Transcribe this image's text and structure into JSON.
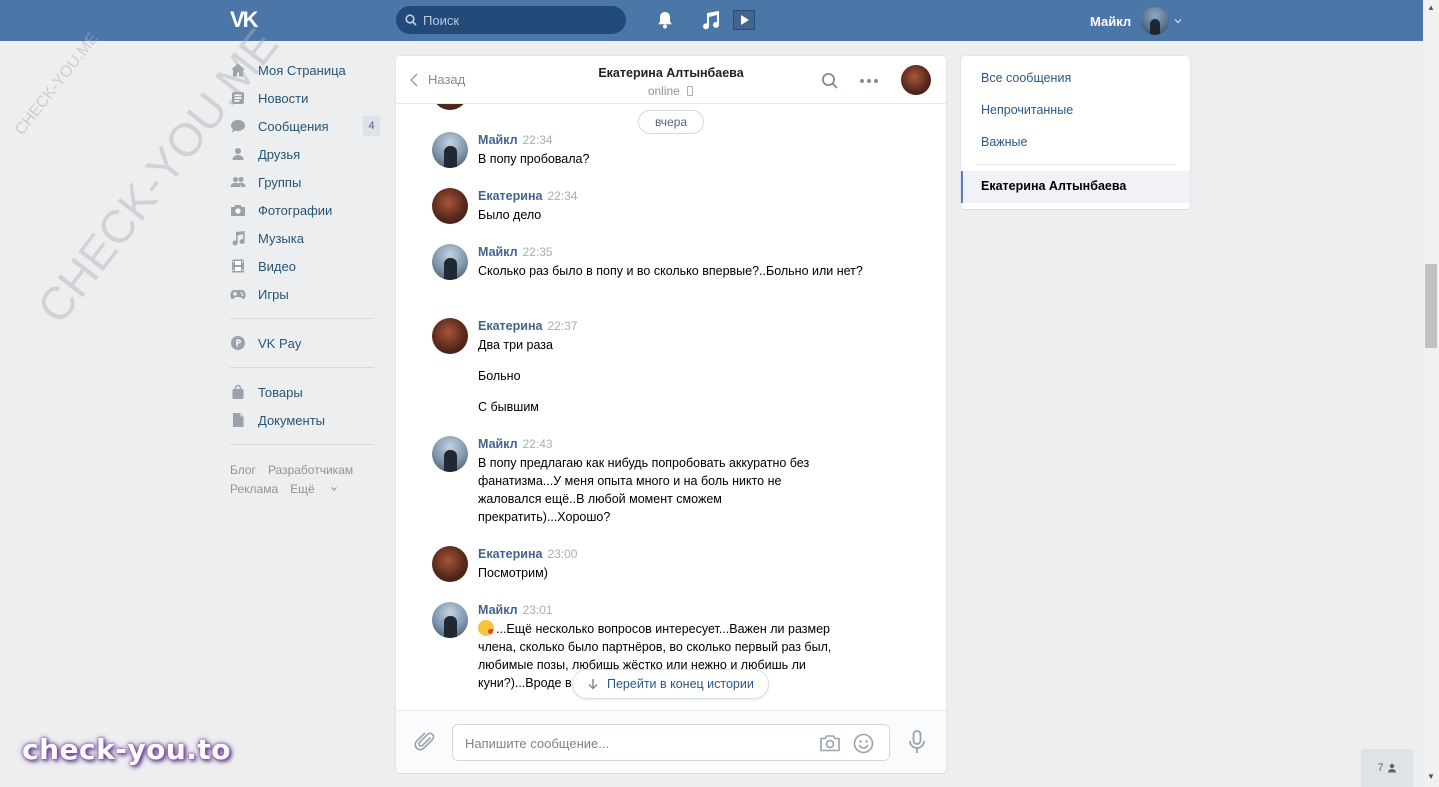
{
  "header": {
    "logo": "VK",
    "search_placeholder": "Поиск",
    "user_name": "Майкл"
  },
  "nav": {
    "items": [
      {
        "label": "Моя Страница",
        "icon": "home-icon"
      },
      {
        "label": "Новости",
        "icon": "news-icon"
      },
      {
        "label": "Сообщения",
        "icon": "messages-icon",
        "badge": "4"
      },
      {
        "label": "Друзья",
        "icon": "friends-icon"
      },
      {
        "label": "Группы",
        "icon": "groups-icon"
      },
      {
        "label": "Фотографии",
        "icon": "camera-icon"
      },
      {
        "label": "Музыка",
        "icon": "music-icon"
      },
      {
        "label": "Видео",
        "icon": "video-icon"
      },
      {
        "label": "Игры",
        "icon": "gamepad-icon"
      }
    ],
    "vkpay": "VK Pay",
    "extra": [
      {
        "label": "Товары",
        "icon": "bag-icon"
      },
      {
        "label": "Документы",
        "icon": "document-icon"
      }
    ],
    "footer": {
      "blog": "Блог",
      "developers": "Разработчикам",
      "ads": "Реклама",
      "more": "Ещё"
    }
  },
  "chat": {
    "back_label": "Назад",
    "title": "Екатерина Алтынбаева",
    "status": "online",
    "date_divider": "вчера",
    "messages": [
      {
        "author": "Майкл",
        "time": "22:34",
        "from": "m",
        "paragraphs": [
          "В попу пробовала?"
        ]
      },
      {
        "author": "Екатерина",
        "time": "22:34",
        "from": "e",
        "paragraphs": [
          "Было дело"
        ]
      },
      {
        "author": "Майкл",
        "time": "22:35",
        "from": "m",
        "paragraphs": [
          "Сколько раз было в попу и во сколько впервые?..Больно или нет?"
        ]
      },
      {
        "author": "Екатерина",
        "time": "22:37",
        "from": "e",
        "paragraphs": [
          "Два три раза",
          "Больно",
          "С бывшим"
        ]
      },
      {
        "author": "Майкл",
        "time": "22:43",
        "from": "m",
        "paragraphs": [
          "В попу предлагаю как нибудь попробовать аккуратно без фанатизма...У меня опыта много и на боль никто не жаловался ещё..В любой момент сможем прекратить)...Хорошо?"
        ]
      },
      {
        "author": "Екатерина",
        "time": "23:00",
        "from": "e",
        "paragraphs": [
          "Посмотрим)"
        ]
      },
      {
        "author": "Майкл",
        "time": "23:01",
        "from": "m",
        "emoji": "kiss-emoji",
        "paragraphs": [
          "...Ещё несколько вопросов интересует...Важен ли размер члена, сколько было партнёров, во сколько первый раз был, любимые позы, любишь жёстко или нежно и любишь ли куни?)...Вроде в"
        ]
      }
    ],
    "jump_to_end": "Перейти в конец истории",
    "composer_placeholder": "Напишите сообщение..."
  },
  "right_panel": {
    "all": "Все сообщения",
    "unread": "Непрочитанные",
    "important": "Важные",
    "active_chat": "Екатерина Алтынбаева"
  },
  "friends_online": "7",
  "watermarks": {
    "brand": "check-you.to",
    "diagonal_small": "CHECK-YOU.ME",
    "diagonal_large": "CHECK-YOU.ME"
  },
  "colors": {
    "header": "#4a76a8",
    "link": "#2a5885",
    "author": "#42648b",
    "background": "#edeef0"
  }
}
